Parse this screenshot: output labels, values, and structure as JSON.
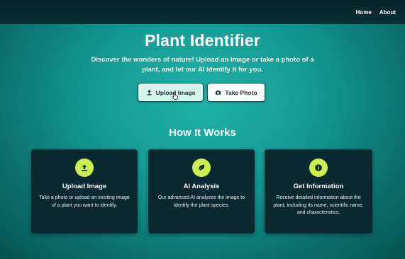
{
  "nav": {
    "home_label": "Home",
    "about_label": "About"
  },
  "hero": {
    "title": "Plant Identifier",
    "subtitle": "Discover the wonders of nature! Upload an image or take a photo of a plant, and let our AI identify it for you."
  },
  "actions": {
    "upload_label": "Upload Image",
    "upload_icon": "upload-icon",
    "photo_label": "Take Photo",
    "photo_icon": "camera-icon"
  },
  "how_it_works": {
    "title": "How It Works",
    "cards": [
      {
        "icon": "upload-icon",
        "title": "Upload Image",
        "description": "Take a photo or upload an existing image of a plant you want to identify."
      },
      {
        "icon": "leaf-icon",
        "title": "AI Analysis",
        "description": "Our advanced AI analyzes the image to identify the plant species."
      },
      {
        "icon": "info-icon",
        "title": "Get Information",
        "description": "Receive detailed information about the plant, including its name, scientific name, and characteristics."
      }
    ]
  },
  "colors": {
    "accent": "#c9f04d",
    "card_bg": "#0a2830",
    "nav_bg": "#06242a",
    "background": "#149a94"
  }
}
